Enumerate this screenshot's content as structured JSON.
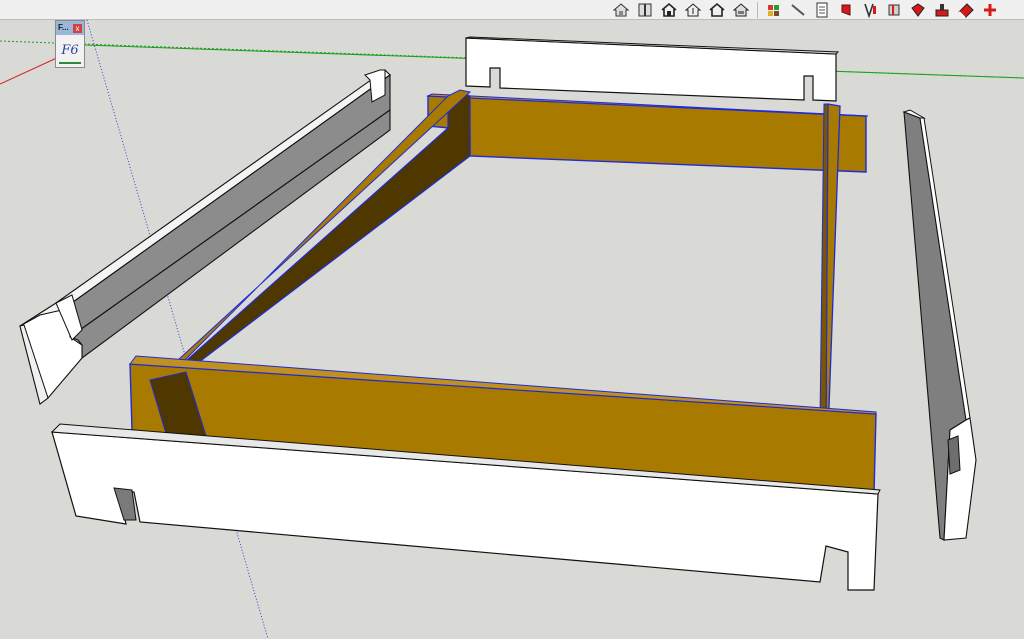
{
  "float_panel": {
    "title": "F...",
    "close_symbol": "x",
    "button_label": "F6"
  },
  "toolbar": {
    "buttons": [
      {
        "name": "warehouse-icon",
        "icon": "warehouse"
      },
      {
        "name": "components-icon",
        "icon": "components"
      },
      {
        "name": "home-icon",
        "icon": "home"
      },
      {
        "name": "share-model-icon",
        "icon": "share-model"
      },
      {
        "name": "house-outline-icon",
        "icon": "house-outline"
      },
      {
        "name": "house-upload-icon",
        "icon": "house-upload"
      },
      {
        "name": "extension-icon",
        "icon": "extension"
      },
      {
        "name": "pencil-tool-icon",
        "icon": "pencil"
      },
      {
        "name": "report-icon",
        "icon": "report"
      },
      {
        "name": "red-tag-icon",
        "icon": "red-tag"
      },
      {
        "name": "section-tool-icon",
        "icon": "section"
      },
      {
        "name": "solid-tool-icon",
        "icon": "solid"
      },
      {
        "name": "paint-bucket-icon",
        "icon": "paint-bucket"
      },
      {
        "name": "stamp-tool-icon",
        "icon": "stamp"
      },
      {
        "name": "eraser-tool-icon",
        "icon": "eraser"
      },
      {
        "name": "add-tool-icon",
        "icon": "add"
      }
    ]
  },
  "colors": {
    "background": "#d9d9d6",
    "wood_face": "#a87a00",
    "wood_dark": "#4f3800",
    "wood_edge": "#7a5600",
    "white_face": "#ffffff",
    "grey_face": "#8a8a8a",
    "grey_dark": "#6e6e6e",
    "selection_blue": "#1f2bd6",
    "axis_red": "#d42020",
    "axis_green": "#19a019",
    "axis_blue": "#3c3cd0"
  }
}
